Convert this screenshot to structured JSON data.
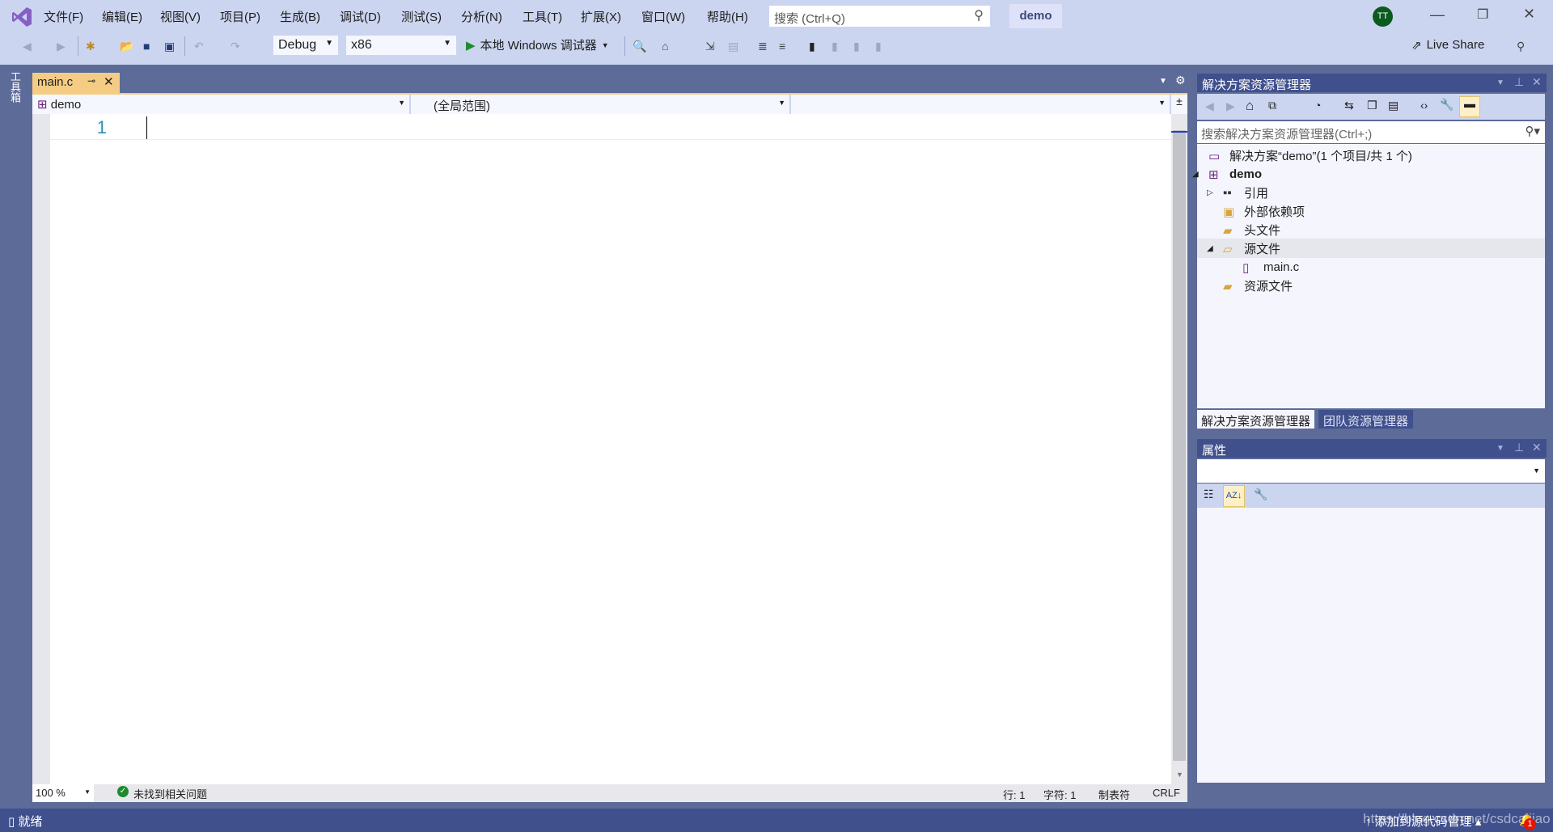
{
  "menu": [
    "文件(F)",
    "编辑(E)",
    "视图(V)",
    "项目(P)",
    "生成(B)",
    "调试(D)",
    "测试(S)",
    "分析(N)",
    "工具(T)",
    "扩展(X)",
    "窗口(W)",
    "帮助(H)"
  ],
  "search": {
    "placeholder": "搜索 (Ctrl+Q)"
  },
  "solution_badge": "demo",
  "avatar": "TT",
  "toolbar": {
    "config": "Debug",
    "platform": "x86",
    "run": "本地 Windows 调试器",
    "live_share": "Live Share"
  },
  "toolbox_label": "工具箱",
  "editor": {
    "tab": "main.c",
    "nav_project": "demo",
    "nav_scope": "(全局范围)",
    "nav_member": "",
    "line_number": "1",
    "zoom": "100 %",
    "issues": "未找到相关问题",
    "line": "行: 1",
    "col": "字符: 1",
    "tabs": "制表符",
    "eol": "CRLF"
  },
  "solution_explorer": {
    "title": "解决方案资源管理器",
    "search_placeholder": "搜索解决方案资源管理器(Ctrl+;)",
    "items": [
      {
        "label": "解决方案“demo”(1 个项目/共 1 个)",
        "icon": "solution-icon"
      },
      {
        "label": "demo",
        "icon": "cpp-project-icon"
      },
      {
        "label": "引用",
        "icon": "references-icon"
      },
      {
        "label": "外部依赖项",
        "icon": "external-deps-icon"
      },
      {
        "label": "头文件",
        "icon": "folder-icon"
      },
      {
        "label": "源文件",
        "icon": "folder-open-icon"
      },
      {
        "label": "main.c",
        "icon": "c-file-icon"
      },
      {
        "label": "资源文件",
        "icon": "folder-icon"
      }
    ],
    "tabs": [
      "解决方案资源管理器",
      "团队资源管理器"
    ]
  },
  "properties": {
    "title": "属性"
  },
  "statusbar": {
    "ready": "就绪",
    "source_control": "添加到源代码管理",
    "notifications": "1",
    "watermark": "https://blog.csdn.net/csdcaijiao"
  },
  "colors": {
    "chrome": "#ccd5f0",
    "dark": "#5d6b99",
    "title": "#40508d",
    "tab_active": "#f5cc84",
    "accent": "#68217a"
  }
}
